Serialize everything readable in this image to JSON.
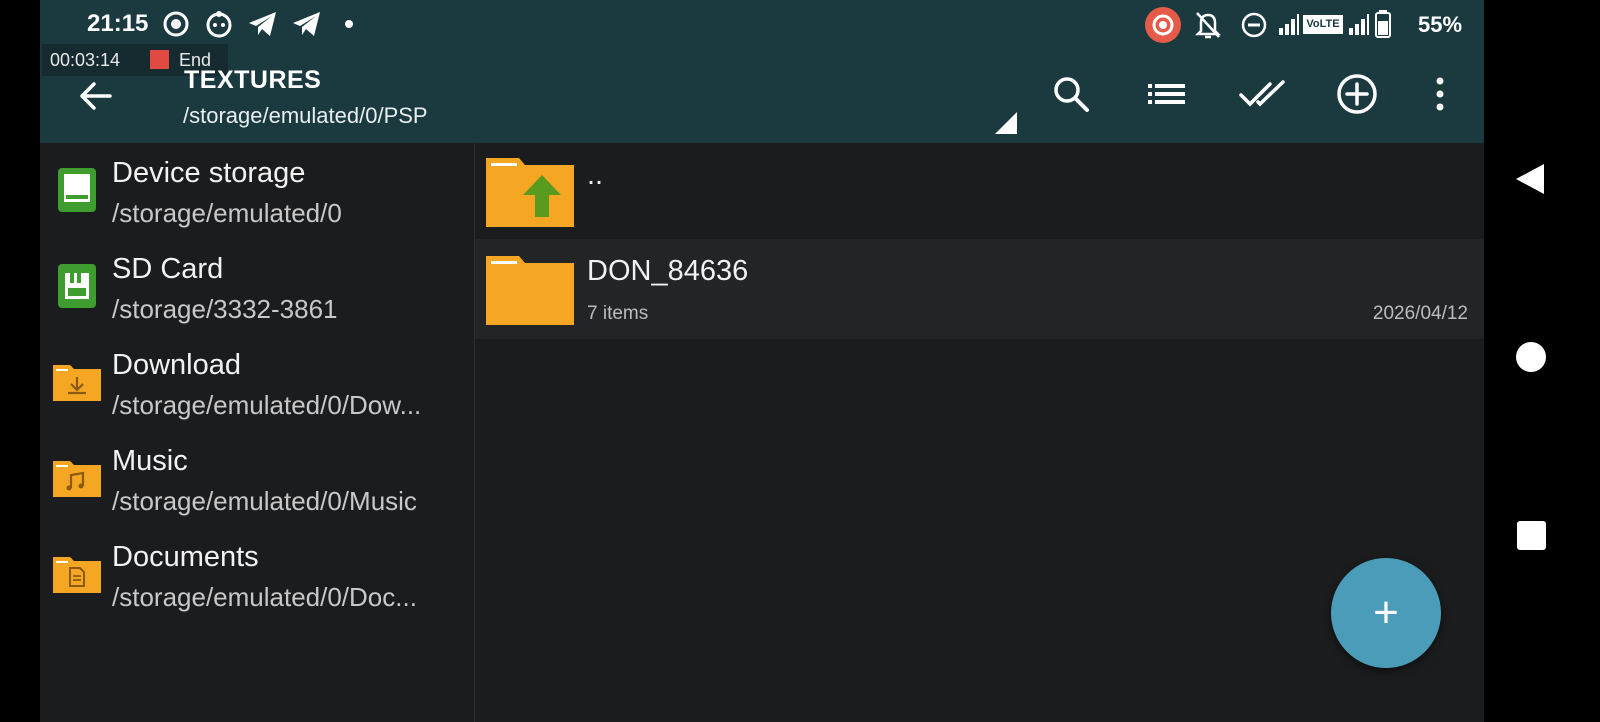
{
  "status_bar": {
    "time": "21:15",
    "battery": "55%",
    "network_badge": "VoLTE",
    "icons": [
      "screen-record-icon",
      "assistant-icon",
      "telegram-icon",
      "telegram-icon",
      "dot-icon",
      "recording-indicator-icon",
      "notifications-off-icon",
      "do-not-disturb-icon",
      "signal-icon",
      "signal-icon",
      "battery-icon"
    ]
  },
  "recording": {
    "elapsed": "00:03:14",
    "end_label": "End"
  },
  "toolbar": {
    "title": "TEXTURES",
    "path": "/storage/emulated/0/PSP",
    "icons": [
      "back-icon",
      "search-icon",
      "list-view-icon",
      "select-all-icon",
      "add-circle-icon",
      "more-vert-icon"
    ]
  },
  "sidebar": {
    "items": [
      {
        "name": "Device storage",
        "path": "/storage/emulated/0",
        "icon": "device-storage-icon"
      },
      {
        "name": "SD Card",
        "path": "/storage/3332-3861",
        "icon": "sd-card-icon"
      },
      {
        "name": "Download",
        "path": "/storage/emulated/0/Dow...",
        "icon": "download-folder-icon"
      },
      {
        "name": "Music",
        "path": "/storage/emulated/0/Music",
        "icon": "music-folder-icon"
      },
      {
        "name": "Documents",
        "path": "/storage/emulated/0/Doc...",
        "icon": "documents-folder-icon"
      }
    ]
  },
  "files": [
    {
      "name": "..",
      "icon": "parent-folder-icon"
    },
    {
      "name": "DON_84636",
      "items": "7 items",
      "date": "2026/04/12",
      "icon": "folder-icon"
    }
  ],
  "fab": {
    "label": "+"
  },
  "colors": {
    "appbar": "#1a3a40",
    "background": "#1b1c1e",
    "folder": "#f5a623",
    "fab": "#4a9cb8",
    "storage_green": "#3f9d2f"
  }
}
